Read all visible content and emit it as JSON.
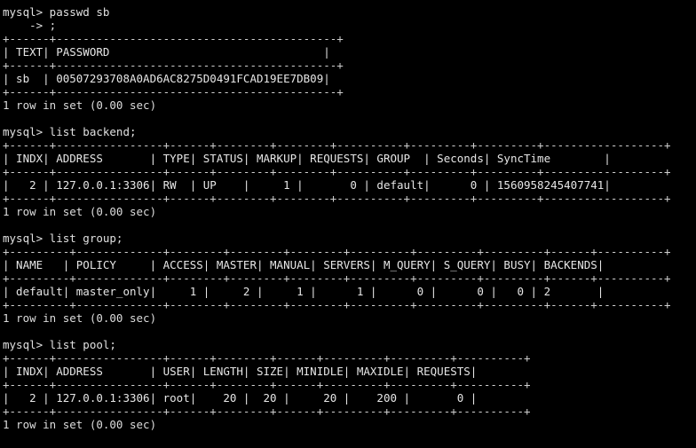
{
  "terminal": {
    "prompt": "mysql>",
    "continuation": "    ->",
    "title": "mysql terminal session",
    "foreground_color": "#d8d8d8",
    "background_color": "#000000",
    "status_line": "1 row in set (0.00 sec)"
  },
  "blocks": [
    {
      "name": "passwd-block",
      "command": "mysql> passwd sb",
      "continuation": "    -> ;",
      "table": {
        "name": "password-table",
        "widths": [
          6,
          42
        ],
        "aligns": [
          "left",
          "left"
        ],
        "headers": [
          "TEXT",
          "PASSWORD"
        ],
        "rows": [
          [
            "sb",
            "00507293708A0AD6AC8275D0491FCAD19EE7DB09"
          ]
        ]
      },
      "status": "1 row in set (0.00 sec)"
    },
    {
      "name": "list-backend-block",
      "command": "mysql> list backend;",
      "continuation": null,
      "table": {
        "name": "backend-table",
        "widths": [
          6,
          16,
          6,
          8,
          8,
          10,
          9,
          9,
          18
        ],
        "aligns": [
          "right",
          "left",
          "left",
          "left",
          "right",
          "right",
          "left",
          "right",
          "left"
        ],
        "headers": [
          "INDX",
          "ADDRESS",
          "TYPE",
          "STATUS",
          "MARKUP",
          "REQUESTS",
          "GROUP",
          "Seconds",
          "SyncTime"
        ],
        "rows": [
          [
            "2",
            "127.0.0.1:3306",
            "RW",
            "UP",
            "1",
            "0",
            "default",
            "0",
            "1560958245407741"
          ]
        ]
      },
      "status": "1 row in set (0.00 sec)"
    },
    {
      "name": "list-group-block",
      "command": "mysql> list group;",
      "continuation": null,
      "table": {
        "name": "group-table",
        "widths": [
          9,
          13,
          8,
          8,
          8,
          9,
          9,
          9,
          6,
          10
        ],
        "aligns": [
          "left",
          "left",
          "right",
          "right",
          "right",
          "right",
          "right",
          "right",
          "right",
          "left"
        ],
        "headers": [
          "NAME",
          "POLICY",
          "ACCESS",
          "MASTER",
          "MANUAL",
          "SERVERS",
          "M_QUERY",
          "S_QUERY",
          "BUSY",
          "BACKENDS"
        ],
        "rows": [
          [
            "default",
            "master_only",
            "1",
            "2",
            "1",
            "1",
            "0",
            "0",
            "0",
            "2"
          ]
        ]
      },
      "status": "1 row in set (0.00 sec)"
    },
    {
      "name": "list-pool-block",
      "command": "mysql> list pool;",
      "continuation": null,
      "table": {
        "name": "pool-table",
        "widths": [
          6,
          16,
          6,
          8,
          6,
          9,
          9,
          10
        ],
        "aligns": [
          "right",
          "left",
          "left",
          "right",
          "right",
          "right",
          "right",
          "right"
        ],
        "headers": [
          "INDX",
          "ADDRESS",
          "USER",
          "LENGTH",
          "SIZE",
          "MINIDLE",
          "MAXIDLE",
          "REQUESTS"
        ],
        "rows": [
          [
            "2",
            "127.0.0.1:3306",
            "root",
            "20",
            "20",
            "20",
            "200",
            "0"
          ]
        ]
      },
      "status": "1 row in set (0.00 sec)"
    }
  ]
}
